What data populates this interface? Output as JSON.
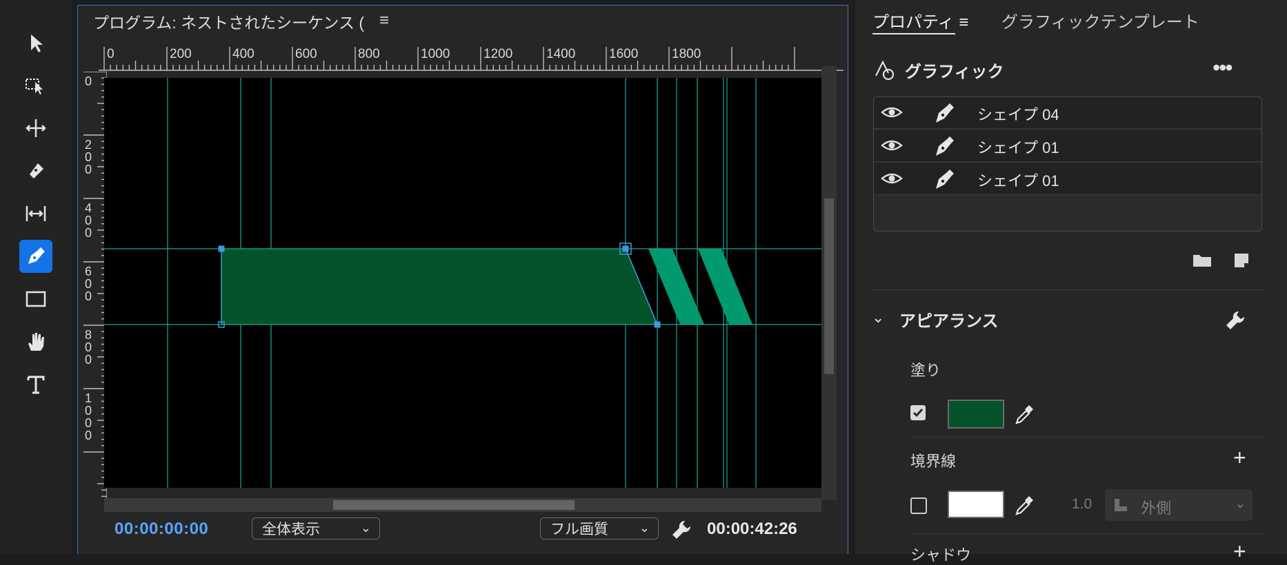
{
  "toolbar": {
    "tools": [
      {
        "name": "selection-tool",
        "icon": "arrow-pointer-icon",
        "active": false
      },
      {
        "name": "track-select-tool",
        "icon": "track-select-icon",
        "active": false
      },
      {
        "name": "ripple-edit-tool",
        "icon": "ripple-edit-icon",
        "active": false
      },
      {
        "name": "razor-tool",
        "icon": "razor-icon",
        "active": false
      },
      {
        "name": "slip-tool",
        "icon": "slip-icon",
        "active": false
      },
      {
        "name": "pen-tool",
        "icon": "pen-icon",
        "active": true
      },
      {
        "name": "rectangle-tool",
        "icon": "rectangle-icon",
        "active": false
      },
      {
        "name": "hand-tool",
        "icon": "hand-icon",
        "active": false
      },
      {
        "name": "type-tool",
        "icon": "type-icon",
        "active": false
      }
    ]
  },
  "monitor": {
    "title": "プログラム: ネストされたシーケンス (",
    "menu_glyph": "≡",
    "ruler_h_labels": [
      "0",
      "200",
      "400",
      "600",
      "800",
      "1000",
      "1200",
      "1400",
      "1600",
      "1800"
    ],
    "ruler_v_labels": [
      "0",
      "200",
      "400",
      "600",
      "800",
      "1000"
    ],
    "timecode_current": "00:00:00:00",
    "zoom": "全体表示",
    "quality": "フル画質",
    "timecode_duration": "00:00:42:26"
  },
  "canvas": {
    "fill_color": "#03532b",
    "stripe_color": "#009a6e",
    "guide_color": "#1aa7a0",
    "anchor_color": "#3a9bdc"
  },
  "properties": {
    "tab_active": "プロパティ",
    "tab_menu_glyph": "≡",
    "tab_other": "グラフィックテンプレート",
    "graphic_title": "グラフィック",
    "more_glyph": "•••",
    "layers": [
      {
        "name": "シェイプ 04"
      },
      {
        "name": "シェイプ 01"
      },
      {
        "name": "シェイプ 01"
      }
    ],
    "appearance": {
      "title": "アピアランス",
      "fill_label": "塗り",
      "fill_checked": true,
      "fill_color": "#03532b",
      "stroke_label": "境界線",
      "stroke_checked": false,
      "stroke_color": "#ffffff",
      "stroke_width": "1.0",
      "stroke_position": "外側",
      "shadow_label": "シャドウ"
    }
  }
}
